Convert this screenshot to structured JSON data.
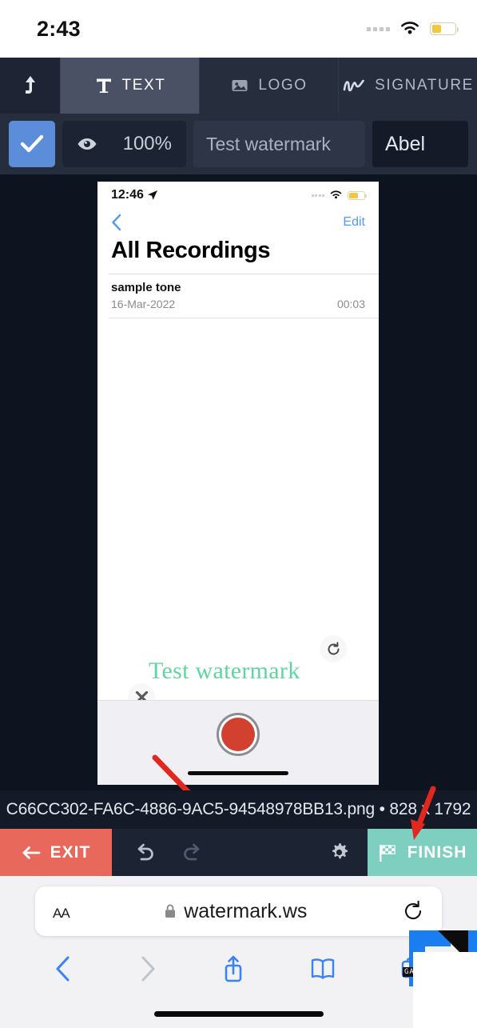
{
  "status_bar": {
    "time": "2:43",
    "wifi_icon": "wifi-icon",
    "battery_icon": "battery-low-power-icon"
  },
  "editor": {
    "upload_tab": {
      "icon": "upload-arrow-icon",
      "label": ""
    },
    "tabs": [
      {
        "label": "TEXT",
        "icon": "text-t-icon",
        "active": true
      },
      {
        "label": "LOGO",
        "icon": "image-icon",
        "active": false
      },
      {
        "label": "SIGNATURE",
        "icon": "signature-squiggle-icon",
        "active": false
      }
    ],
    "options": {
      "apply_checkbox": {
        "icon": "checkmark-icon",
        "checked": true,
        "color": "#5b8ddb"
      },
      "opacity": {
        "icon": "eye-icon",
        "value": "100%"
      },
      "watermark_text": {
        "value": "Test watermark",
        "placeholder": "Test watermark"
      },
      "font": {
        "value": "Abel"
      }
    }
  },
  "preview": {
    "inner_phone": {
      "status": {
        "time": "12:46",
        "location_icon": "location-arrow-icon",
        "wifi_icon": "wifi-icon",
        "battery_icon": "battery-icon"
      },
      "nav": {
        "back_icon": "chevron-left-icon",
        "edit_label": "Edit"
      },
      "title": "All Recordings",
      "recordings": [
        {
          "name": "sample tone",
          "date": "16-Mar-2022",
          "duration": "00:03"
        }
      ],
      "record_button": {
        "icon": "record-circle-icon",
        "color": "#d2402f"
      }
    },
    "watermark": {
      "text": "Test watermark",
      "color": "#5fd6a0",
      "delete_handle_icon": "close-x-icon",
      "rotate_handle_icon": "rotate-cw-icon"
    },
    "annotations": [
      {
        "name": "arrow-to-watermark",
        "color": "#e0281e"
      },
      {
        "name": "arrow-to-finish",
        "color": "#e0281e"
      }
    ]
  },
  "file_info": {
    "text": "C66CC302-FA6C-4886-9AC5-94548978BB13.png • 828 x 1792"
  },
  "action_bar": {
    "exit": {
      "label": "EXIT",
      "icon": "arrow-left-icon",
      "color": "#e8695c"
    },
    "undo": {
      "icon": "undo-icon",
      "enabled": true
    },
    "redo": {
      "icon": "redo-icon",
      "enabled": false
    },
    "settings": {
      "icon": "gear-icon"
    },
    "finish": {
      "label": "FINISH",
      "icon": "checkered-flag-icon",
      "color": "#7fcfc0"
    }
  },
  "browser": {
    "text_size_label": "AA",
    "lock_icon": "lock-icon",
    "url": "watermark.ws",
    "reload_icon": "reload-icon",
    "toolbar": [
      {
        "name": "back-icon",
        "enabled": true
      },
      {
        "name": "forward-icon",
        "enabled": false
      },
      {
        "name": "share-icon",
        "enabled": true
      },
      {
        "name": "bookmarks-icon",
        "enabled": true
      },
      {
        "name": "tabs-icon",
        "enabled": true
      }
    ],
    "overlay_logo": {
      "label": "GAD",
      "color": "#1a7ef0"
    }
  }
}
